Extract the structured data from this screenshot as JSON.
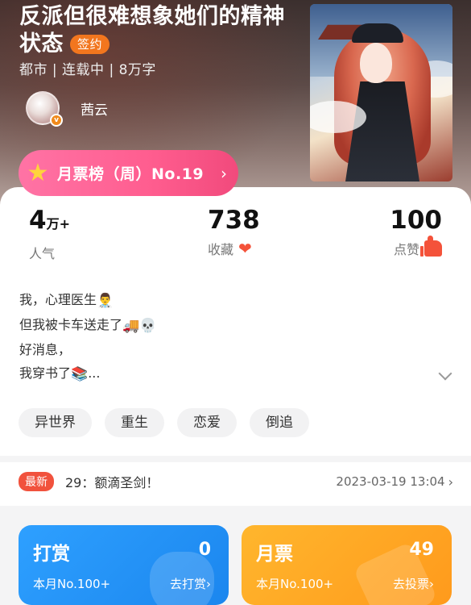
{
  "book": {
    "title": "反派但很难想象她们的精神状态",
    "sign_badge": "签约",
    "meta": "都市 | 连载中 | 8万字"
  },
  "author": {
    "name": "茜云",
    "verified_icon": "v-badge-icon"
  },
  "ranking": {
    "label": "月票榜（周）No.19",
    "icon": "star-icon"
  },
  "stats": {
    "popularity": {
      "value": "4",
      "unit": "万+",
      "label": "人气"
    },
    "favorites": {
      "value": "738",
      "label": "收藏",
      "icon": "heart-icon"
    },
    "likes": {
      "value": "100",
      "label": "点赞",
      "icon": "thumbs-up-icon"
    }
  },
  "synopsis": {
    "line1": "我，心理医生",
    "line1_emoji": "👨‍⚕️",
    "line2": "但我被卡车送走了",
    "line2_emoji": "🚚💀",
    "line3": "好消息，",
    "line4": "我穿书了",
    "line4_emoji": "📚",
    "line4_suffix": "..."
  },
  "tags": [
    "异世界",
    "重生",
    "恋爱",
    "倒追"
  ],
  "latest": {
    "badge": "最新",
    "chapter": "29：额滴圣剑！",
    "time": "2023-03-19 13:04"
  },
  "actions": {
    "reward": {
      "title": "打赏",
      "count": "0",
      "rank": "本月No.100+",
      "link": "去打赏"
    },
    "ticket": {
      "title": "月票",
      "count": "49",
      "rank": "本月No.100+",
      "link": "去投票"
    }
  },
  "colors": {
    "accent_orange": "#f2761e",
    "rank_pink": "#ff5d8f",
    "heart_red": "#f4523a",
    "reward_blue": "#1b86ee",
    "ticket_orange": "#ff9a1c"
  }
}
